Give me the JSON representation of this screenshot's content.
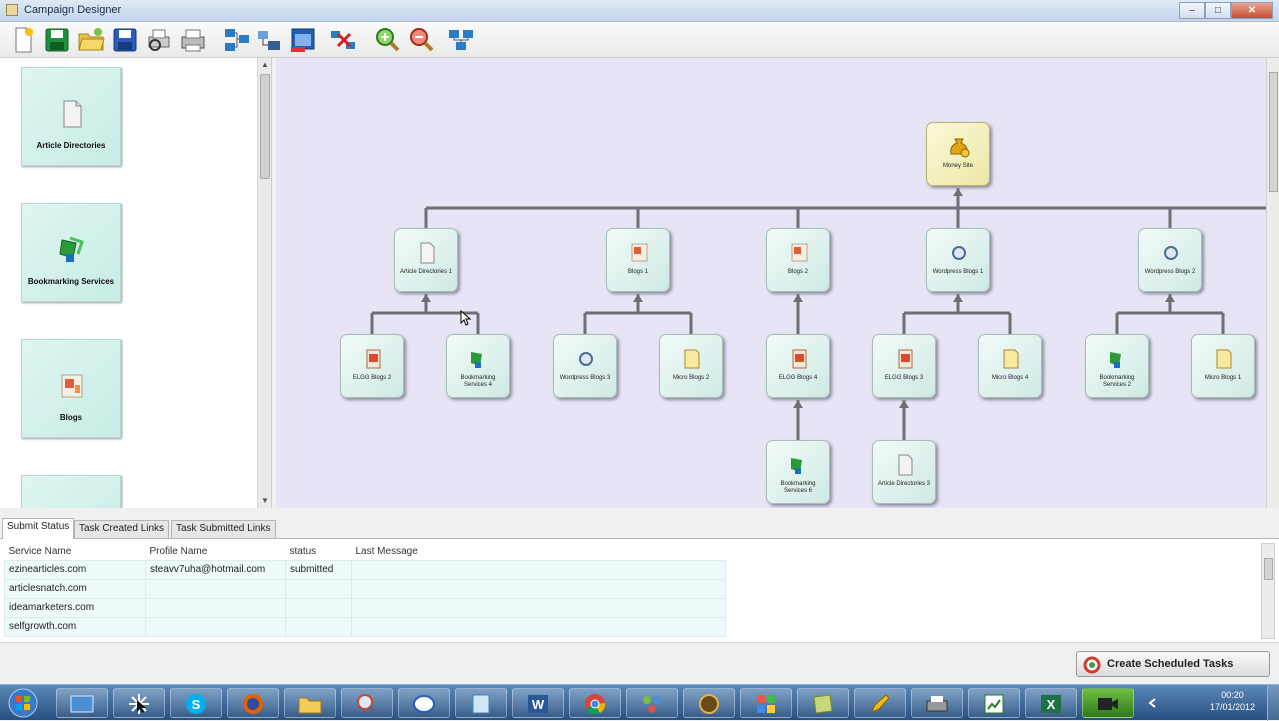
{
  "window": {
    "title": "Campaign Designer",
    "minimize_glyph": "–",
    "maximize_glyph": "□",
    "close_glyph": "✕"
  },
  "toolbar": {
    "buttons": [
      {
        "name": "new-icon"
      },
      {
        "name": "save-icon"
      },
      {
        "name": "open-folder-icon"
      },
      {
        "name": "save-as-icon"
      },
      {
        "name": "print-preview-icon"
      },
      {
        "name": "print-icon"
      },
      {
        "name": "add-node-icon"
      },
      {
        "name": "link-nodes-icon"
      },
      {
        "name": "window-icon"
      },
      {
        "name": "remove-link-icon"
      },
      {
        "name": "zoom-in-icon"
      },
      {
        "name": "zoom-out-icon"
      },
      {
        "name": "layout-icon"
      }
    ]
  },
  "palette": {
    "items": [
      {
        "label": "Article Directories",
        "icon": "document-icon"
      },
      {
        "label": "Bookmarking Services",
        "icon": "bookmark-icon"
      },
      {
        "label": "Blogs",
        "icon": "blog-icon"
      },
      {
        "label": "",
        "icon": ""
      }
    ]
  },
  "diagram": {
    "root": {
      "label": "Money Site",
      "icon": "money-bag-icon"
    },
    "level1": [
      {
        "label": "Article Directories 1",
        "icon": "document-icon"
      },
      {
        "label": "Blogs 1",
        "icon": "blog-icon"
      },
      {
        "label": "Blogs 2",
        "icon": "blog-icon"
      },
      {
        "label": "Wordpress Blogs 1",
        "icon": "wordpress-icon"
      },
      {
        "label": "Wordpress Blogs 2",
        "icon": "wordpress-icon"
      }
    ],
    "level2": [
      {
        "label": "ELGG Blogs 2",
        "icon": "elgg-icon"
      },
      {
        "label": "Bookmarking Services 4",
        "icon": "bookmark-icon"
      },
      {
        "label": "Wordpress Blogs 3",
        "icon": "wordpress-icon"
      },
      {
        "label": "Micro Blogs 2",
        "icon": "note-icon"
      },
      {
        "label": "ELGG Blogs 4",
        "icon": "elgg-icon"
      },
      {
        "label": "ELGG Blogs 3",
        "icon": "elgg-icon"
      },
      {
        "label": "Micro Blogs 4",
        "icon": "note-icon"
      },
      {
        "label": "Bookmarking Services 2",
        "icon": "bookmark-icon"
      },
      {
        "label": "Micro Blogs 1",
        "icon": "note-icon"
      }
    ],
    "level3": [
      {
        "label": "Bookmarking Services 6",
        "icon": "bookmark-icon"
      },
      {
        "label": "Article Directories 3",
        "icon": "document-icon"
      }
    ]
  },
  "tabs": [
    {
      "label": "Submit Status",
      "active": true
    },
    {
      "label": "Task Created Links",
      "active": false
    },
    {
      "label": "Task Submitted Links",
      "active": false
    }
  ],
  "grid": {
    "columns": [
      "Service Name",
      "Profile Name",
      "status",
      "Last Message"
    ],
    "rows": [
      [
        "ezinearticles.com",
        "steavv7uha@hotmail.com",
        "submitted",
        ""
      ],
      [
        "articlesnatch.com",
        "",
        "",
        ""
      ],
      [
        "ideamarketers.com",
        "",
        "",
        ""
      ],
      [
        "selfgrowth.com",
        "",
        "",
        ""
      ]
    ]
  },
  "actions": {
    "create_label": "Create Scheduled Tasks"
  },
  "taskbar": {
    "apps": [
      "explorer-icon",
      "cursor-tool-icon",
      "skype-icon",
      "firefox-icon",
      "folder-icon",
      "magnifier-icon",
      "messenger-icon",
      "notepad-icon",
      "word-icon",
      "chrome-icon",
      "network-icon",
      "app-icon",
      "grid-app-icon",
      "note-app-icon",
      "pencil-icon",
      "printer-icon",
      "chart-app-icon",
      "excel-icon",
      "recorder-icon"
    ],
    "clock_time": "00:20",
    "clock_date": "17/01/2012"
  },
  "colors": {
    "canvas_bg": "#e7e5f5",
    "node_bg": "#cfe9e4",
    "root_bg": "#ece7a7",
    "taskbar": "#27507f"
  }
}
